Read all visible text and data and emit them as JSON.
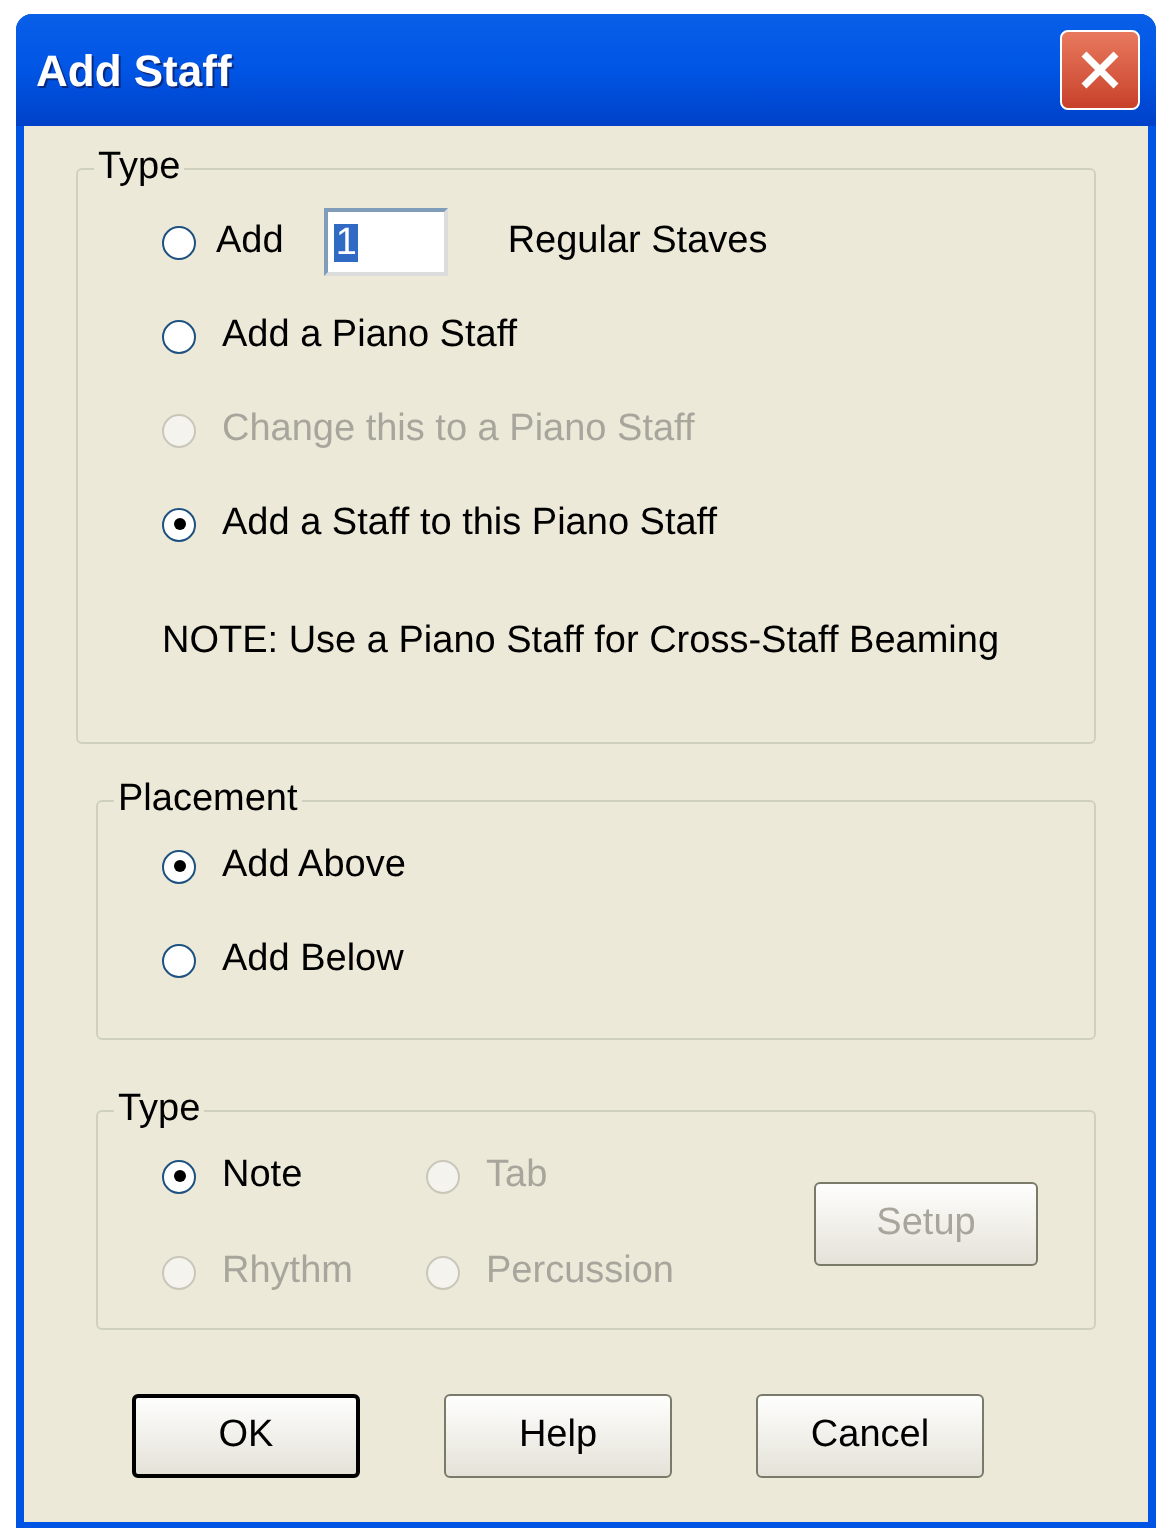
{
  "window": {
    "title": "Add Staff"
  },
  "groups": [
    {
      "title": "Type",
      "kind": "list",
      "items": [
        {
          "kind": "count",
          "label": "Add",
          "value": "1",
          "suffix": "Regular Staves",
          "selected": false,
          "disabled": false
        },
        {
          "kind": "radio",
          "label": "Add a Piano Staff",
          "selected": false,
          "disabled": false
        },
        {
          "kind": "radio",
          "label": "Change this to a Piano Staff",
          "selected": false,
          "disabled": true
        },
        {
          "kind": "radio",
          "label": "Add a Staff to this Piano Staff",
          "selected": true,
          "disabled": false
        }
      ],
      "note": "NOTE: Use a Piano Staff for Cross-Staff Beaming"
    },
    {
      "title": "Placement",
      "kind": "list",
      "items": [
        {
          "kind": "radio",
          "label": "Add Above",
          "selected": true,
          "disabled": false
        },
        {
          "kind": "radio",
          "label": "Add Below",
          "selected": false,
          "disabled": false
        }
      ]
    },
    {
      "title": "Type",
      "kind": "grid",
      "items": [
        {
          "kind": "radio",
          "label": "Note",
          "selected": true,
          "disabled": false
        },
        {
          "kind": "radio",
          "label": "Tab",
          "selected": false,
          "disabled": true
        },
        {
          "kind": "radio",
          "label": "Rhythm",
          "selected": false,
          "disabled": true
        },
        {
          "kind": "radio",
          "label": "Percussion",
          "selected": false,
          "disabled": true
        }
      ],
      "button": {
        "label": "Setup",
        "disabled": true
      }
    }
  ],
  "buttons": [
    {
      "label": "OK",
      "default": true
    },
    {
      "label": "Help",
      "default": false
    },
    {
      "label": "Cancel",
      "default": false
    }
  ]
}
